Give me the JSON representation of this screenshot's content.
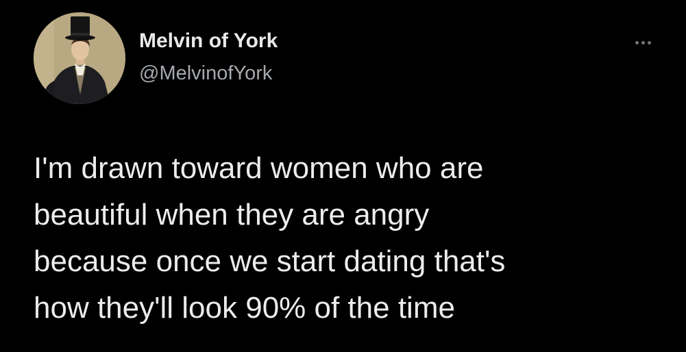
{
  "tweet": {
    "display_name": "Melvin of York",
    "handle": "@MelvinofYork",
    "avatar_icon": "victorian-gentleman-portrait",
    "more_icon": "more-horizontal-icon",
    "text": "I'm drawn toward women who are\nbeautiful when they are angry\nbecause once we start dating that's\nhow they'll look 90% of the time"
  },
  "colors": {
    "background": "#000000",
    "primary_text": "#e7e9ea",
    "secondary_text": "#a5a9ad",
    "icon": "#71767b"
  }
}
